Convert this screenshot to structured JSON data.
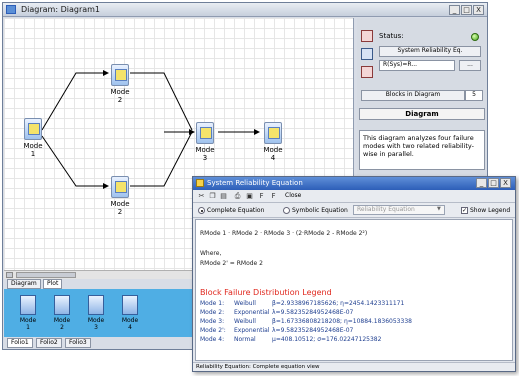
{
  "main_window": {
    "title": "Diagram: Diagram1",
    "buttons": [
      "_",
      "□",
      "X"
    ]
  },
  "diagram": {
    "blocks": [
      {
        "id": "mode1",
        "label": "Mode",
        "sub": "1"
      },
      {
        "id": "mode2a",
        "label": "Mode",
        "sub": "2"
      },
      {
        "id": "mode2b",
        "label": "Mode",
        "sub": "2"
      },
      {
        "id": "mode3",
        "label": "Mode",
        "sub": "3"
      },
      {
        "id": "mode4",
        "label": "Mode",
        "sub": "4"
      }
    ]
  },
  "tabs": {
    "diagram": "Diagram",
    "plot": "Plot"
  },
  "folio_tabs": [
    "Folio1",
    "Folio2",
    "Folio3"
  ],
  "block_panel": [
    {
      "label": "Mode",
      "sub": "1"
    },
    {
      "label": "Mode",
      "sub": "2"
    },
    {
      "label": "Mode",
      "sub": "3"
    },
    {
      "label": "Mode",
      "sub": "4"
    }
  ],
  "side_panel": {
    "status_label": "Status:",
    "system_button": "System Reliability Eq.",
    "eq_field": "R(Sys)=R...",
    "eq_more": "...",
    "blocks_label": "Blocks in Diagram",
    "blocks_count": "5",
    "desc_header": "Diagram",
    "desc_text": "This diagram analyzes four failure modes with two related reliability-wise in parallel."
  },
  "rel_window": {
    "title": "System Reliability Equation",
    "buttons": [
      "_",
      "□",
      "X"
    ],
    "toolbar_close": "Close",
    "complete_label": "Complete Equation",
    "symbolic_label": "Symbolic Equation",
    "dropdown_placeholder": "Reliability Equation",
    "show_legend": "Show Legend",
    "equation": "RMode 1 · RMode 2 · RMode 3 · (2·RMode 2 - RMode 2²)",
    "where": "Where,",
    "where_eq": "RMode 2' = RMode 2",
    "legend_title": "Block Failure Distribution Legend",
    "legend": [
      {
        "name": "Mode 1:",
        "dist": "Weibull",
        "params": "β=2.9338967185626; η=2454.1423311171"
      },
      {
        "name": "Mode 2:",
        "dist": "Exponential",
        "params": "λ=9.58235284952468E-07"
      },
      {
        "name": "Mode 3:",
        "dist": "Weibull",
        "params": "β=1.67336808218208; η=10884.1836053338"
      },
      {
        "name": "Mode 2':",
        "dist": "Exponential",
        "params": "λ=9.58235284952468E-07"
      },
      {
        "name": "Mode 4:",
        "dist": "Normal",
        "params": "μ=408.10512; σ=176.02247125382"
      }
    ],
    "status": "Reliability Equation: Complete equation view"
  },
  "colors": {
    "accent": "#2d5eb8",
    "legend_title": "#e0281e",
    "panel_bg": "#4faee4",
    "status_ok": "#48a81c"
  }
}
